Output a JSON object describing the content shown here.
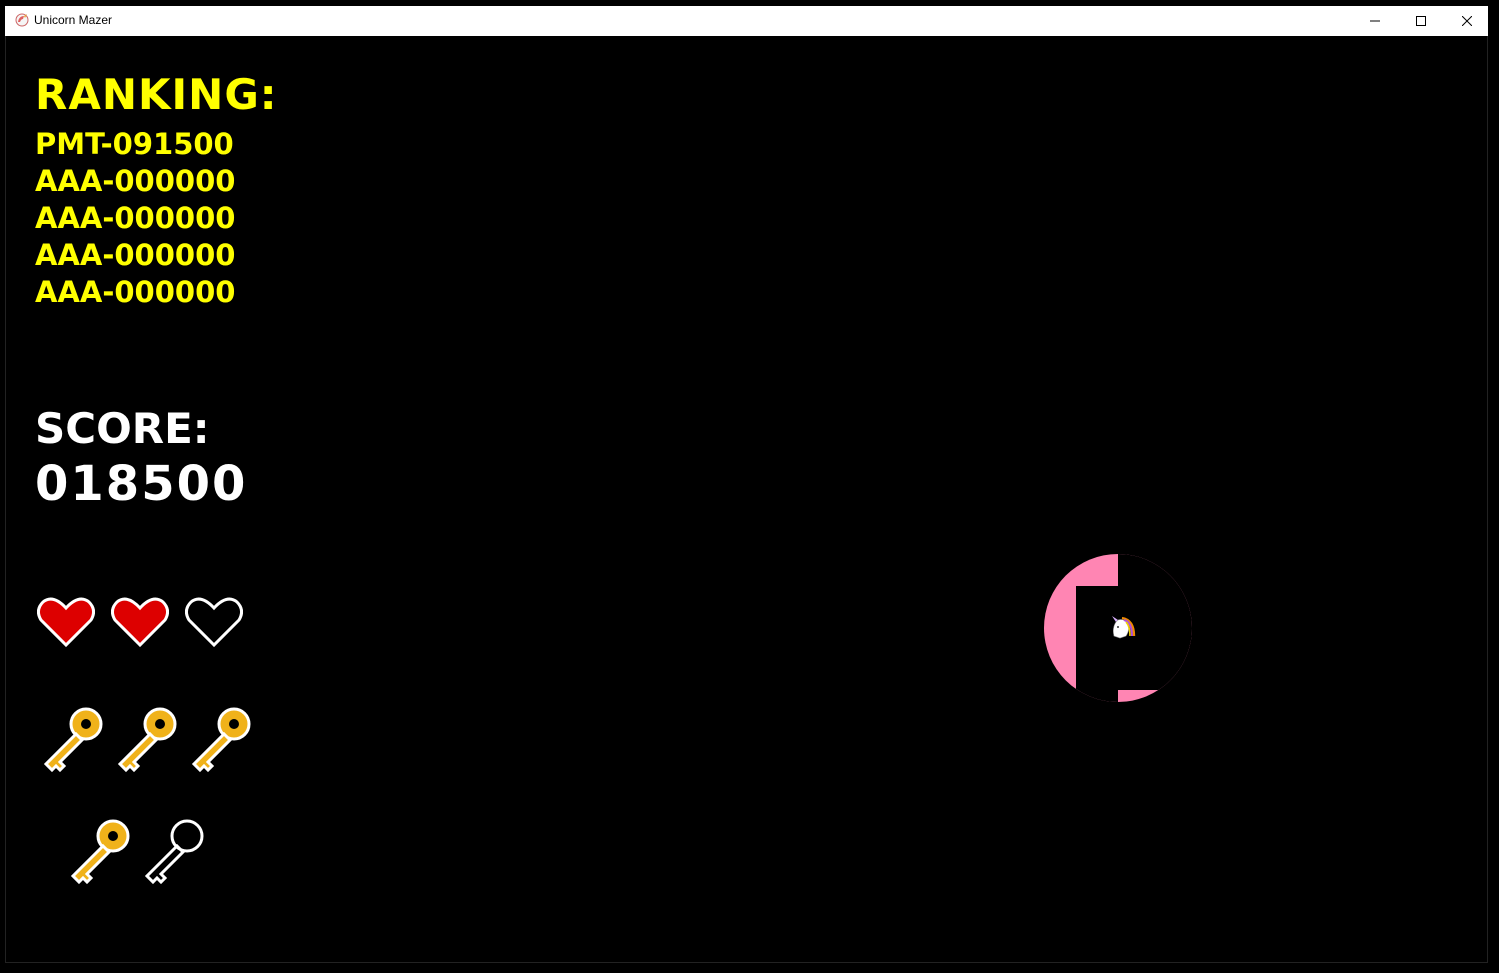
{
  "window": {
    "title": "Unicorn Mazer"
  },
  "ranking": {
    "title": "RANKING:",
    "entries": [
      "PMT-091500",
      "AAA-000000",
      "AAA-000000",
      "AAA-000000",
      "AAA-000000"
    ]
  },
  "score": {
    "label": "SCORE:",
    "value": "018500"
  },
  "lives": {
    "total": 3,
    "filled": 2
  },
  "keys": {
    "total": 5,
    "collected": 4
  },
  "colors": {
    "ranking_text": "#ffff00",
    "score_text": "#ffffff",
    "heart_full": "#dd0000",
    "key_gold": "#f0b21a",
    "light_pink": "#ff85b3",
    "background": "#000000"
  }
}
